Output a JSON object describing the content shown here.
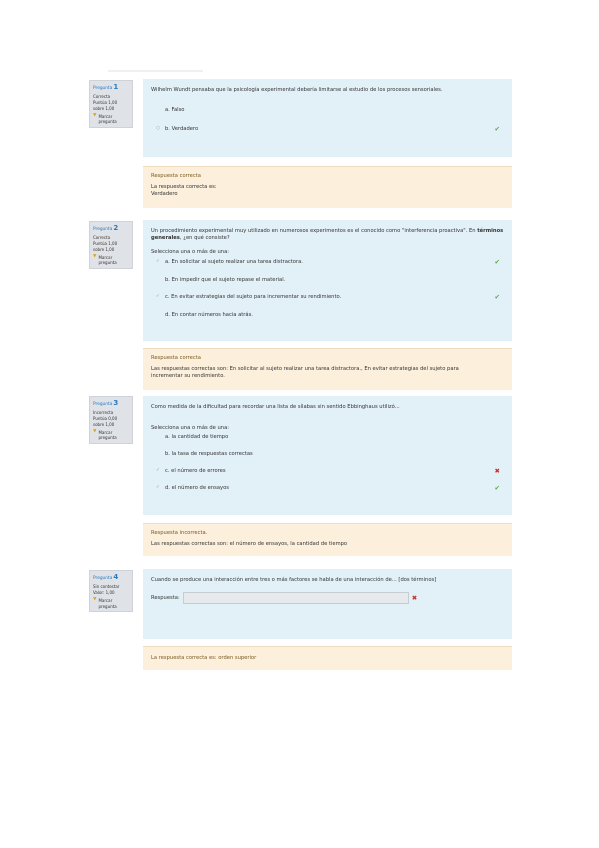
{
  "questions": [
    {
      "label": "Pregunta",
      "number": "1",
      "state": "Correcta",
      "grade_line1": "Puntúa 1,00",
      "grade_line2": "sobre 1,00",
      "flag_label": "Marcar pregunta",
      "text": "Wilhelm Wundt pensaba que la psicología experimental debería limitarse al estudio de los procesos sensoriales.",
      "answers": [
        {
          "text": "a. Falso",
          "mark": "",
          "result": ""
        },
        {
          "text": "b. Verdadero",
          "mark": "○",
          "result": "correct"
        }
      ],
      "feedback": {
        "title": "Respuesta correcta",
        "line1": "La respuesta correcta es:",
        "line2": "Verdadero"
      }
    },
    {
      "label": "Pregunta",
      "number": "2",
      "state": "Correcta",
      "grade_line1": "Puntúa 1,00",
      "grade_line2": "sobre 1,00",
      "flag_label": "Marcar pregunta",
      "text_pre": "Un procedimiento experimental muy utilizado en numerosos experimentos es el conocido como \"interferencia proactiva\". En",
      "text_bold": "términos generales",
      "text_post": ", ¿en qué consiste?",
      "prompt": "Selecciona una o más de una:",
      "answers": [
        {
          "text": "a. En solicitar al sujeto realizar una tarea distractora.",
          "mark": "✓",
          "result": "correct"
        },
        {
          "text": "b. En impedir que el sujeto repase el material.",
          "mark": "",
          "result": ""
        },
        {
          "text": "c. En evitar estrategias del sujeto para incrementar su rendimiento.",
          "mark": "✓",
          "result": "correct"
        },
        {
          "text": "d. En contar números hacia atrás.",
          "mark": "",
          "result": ""
        }
      ],
      "feedback": {
        "title": "Respuesta correcta",
        "line1": "Las respuestas correctas son: En solicitar al sujeto realizar una tarea distractora., En evitar estrategias del sujeto para",
        "line2": "incrementar su rendimiento."
      }
    },
    {
      "label": "Pregunta",
      "number": "3",
      "state": "Incorrecta",
      "grade_line1": "Puntúa 0,00",
      "grade_line2": "sobre 1,00",
      "flag_label": "Marcar pregunta",
      "text": "Como medida de la dificultad para recordar una lista de sílabas sin sentido Ebbinghaus utilizó...",
      "prompt": "Selecciona una o más de una:",
      "answers": [
        {
          "text": "a. la cantidad de tiempo",
          "mark": "",
          "result": ""
        },
        {
          "text": "b. la tasa de respuestas correctas",
          "mark": "",
          "result": ""
        },
        {
          "text": "c. el número de errores",
          "mark": "✓",
          "result": "incorrect"
        },
        {
          "text": "d. el número de ensayos",
          "mark": "✓",
          "result": "correct"
        }
      ],
      "feedback": {
        "title": "Respuesta incorrecta.",
        "line1": "Las respuestas correctas son: el número de ensayos, la cantidad de tiempo"
      }
    },
    {
      "label": "Pregunta",
      "number": "4",
      "state": "Sin contestar",
      "grade_line1": "Valor: 1,00",
      "flag_label": "Marcar pregunta",
      "text": "Cuando se produce una interacción entre tres o más factores se habla de una interacción de... [dos términos]",
      "answer_label": "Respuesta:",
      "answer_value": "",
      "feedback": {
        "title": "La respuesta correcta es: orden superior"
      }
    }
  ],
  "icons": {
    "correct": "✔",
    "incorrect": "✖",
    "flag": "▼"
  },
  "colors": {
    "correct": "#5aa64e",
    "incorrect": "#c9302c",
    "question_bg": "#e2f0f7",
    "feedback_bg": "#fcefdc",
    "link": "#2a7abf"
  }
}
